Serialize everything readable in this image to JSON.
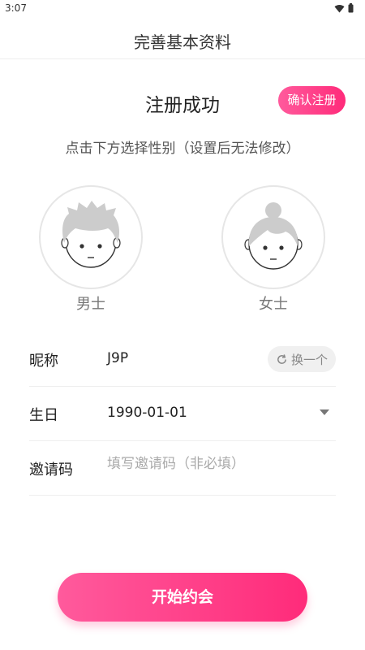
{
  "status_bar": {
    "time": "3:07",
    "icons": [
      "wifi-icon",
      "battery-icon"
    ]
  },
  "header": {
    "title": "完善基本资料"
  },
  "registration": {
    "title": "注册成功",
    "confirm_label": "确认注册"
  },
  "instruction": "点击下方选择性别（设置后无法修改）",
  "genders": [
    {
      "label": "男士",
      "icon": "male-avatar-icon"
    },
    {
      "label": "女士",
      "icon": "female-avatar-icon"
    }
  ],
  "form": {
    "nickname": {
      "label": "昵称",
      "value": "J9P",
      "swap_label": "换一个"
    },
    "birthday": {
      "label": "生日",
      "value": "1990-01-01"
    },
    "invite": {
      "label": "邀请码",
      "placeholder": "填写邀请码（非必填）"
    }
  },
  "start_button": {
    "label": "开始约会"
  },
  "colors": {
    "accent": "#ff3c86",
    "accent_light": "#ff5a9c",
    "avatar_gray": "#cccccc"
  }
}
